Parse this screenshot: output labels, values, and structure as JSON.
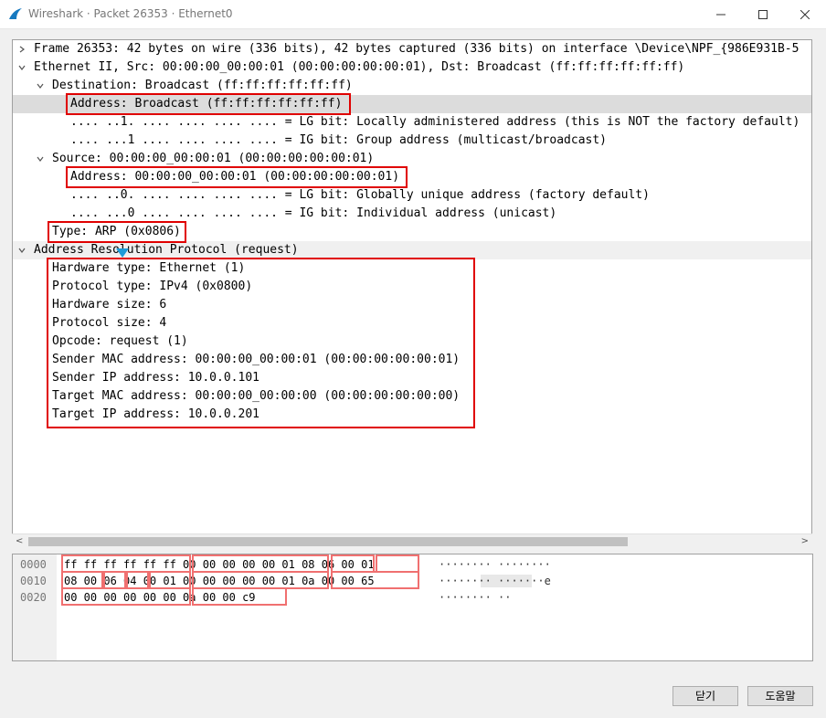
{
  "window": {
    "title": "Wireshark · Packet 26353 · Ethernet0",
    "controls": {
      "minimize": "minimize-icon",
      "maximize": "maximize-icon",
      "close": "close-icon"
    }
  },
  "tree": {
    "rows": [
      {
        "text": "Frame 26353: 42 bytes on wire (336 bits), 42 bytes captured (336 bits) on interface \\Device\\NPF_{986E931B-5",
        "expander": "collapsed"
      },
      {
        "text": "Ethernet II, Src: 00:00:00_00:00:01 (00:00:00:00:00:01), Dst: Broadcast (ff:ff:ff:ff:ff:ff)",
        "expander": "expanded"
      },
      {
        "text": "Destination: Broadcast (ff:ff:ff:ff:ff:ff)",
        "expander": "expanded"
      },
      {
        "text": "Address: Broadcast (ff:ff:ff:ff:ff:ff)",
        "expander": "none",
        "selected": true
      },
      {
        "text": ".... ..1. .... .... .... .... = LG bit: Locally administered address (this is NOT the factory default)",
        "expander": "none"
      },
      {
        "text": ".... ...1 .... .... .... .... = IG bit: Group address (multicast/broadcast)",
        "expander": "none"
      },
      {
        "text": "Source: 00:00:00_00:00:01 (00:00:00:00:00:01)",
        "expander": "expanded"
      },
      {
        "text": "Address: 00:00:00_00:00:01 (00:00:00:00:00:01)",
        "expander": "none"
      },
      {
        "text": ".... ..0. .... .... .... .... = LG bit: Globally unique address (factory default)",
        "expander": "none"
      },
      {
        "text": ".... ...0 .... .... .... .... = IG bit: Individual address (unicast)",
        "expander": "none"
      },
      {
        "text": "Type: ARP (0x0806)",
        "expander": "none"
      },
      {
        "text": "Address Resolution Protocol (request)",
        "expander": "expanded"
      },
      {
        "text": "Hardware type: Ethernet (1)",
        "expander": "none"
      },
      {
        "text": "Protocol type: IPv4 (0x0800)",
        "expander": "none"
      },
      {
        "text": "Hardware size: 6",
        "expander": "none"
      },
      {
        "text": "Protocol size: 4",
        "expander": "none"
      },
      {
        "text": "Opcode: request (1)",
        "expander": "none"
      },
      {
        "text": "Sender MAC address: 00:00:00_00:00:01 (00:00:00:00:00:01)",
        "expander": "none"
      },
      {
        "text": "Sender IP address: 10.0.0.101",
        "expander": "none"
      },
      {
        "text": "Target MAC address: 00:00:00_00:00:00 (00:00:00:00:00:00)",
        "expander": "none"
      },
      {
        "text": "Target IP address: 10.0.0.201",
        "expander": "none"
      }
    ]
  },
  "bytes": {
    "rows": [
      {
        "offset": "0000",
        "hex": "ff ff ff ff ff ff 00 00  00 00 00 01 08 06 00 01",
        "ascii": "········ ········"
      },
      {
        "offset": "0010",
        "hex": "08 00 06 04 00 01 00 00  00 00 00 01 0a 00 00 65",
        "ascii": "········ ·······e"
      },
      {
        "offset": "0020",
        "hex": "00 00 00 00 00 00 0a 00  00 c9",
        "ascii": "········ ··"
      }
    ]
  },
  "buttons": {
    "close": "닫기",
    "help": "도움말"
  },
  "colors": {
    "highlight_red": "#e00000",
    "hex_highlight": "#f07070",
    "selection": "#dcdcdc",
    "marker": "#1e9bd8"
  }
}
